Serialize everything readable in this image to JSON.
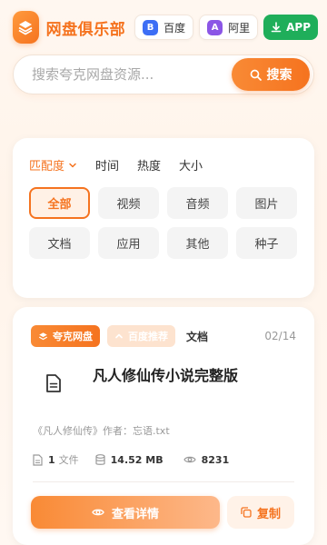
{
  "header": {
    "site_title": "网盘俱乐部",
    "baidu": {
      "badge": "B",
      "label": "百度"
    },
    "aliyun": {
      "badge": "A",
      "label": "阿里"
    },
    "app_label": "APP"
  },
  "search": {
    "placeholder": "搜索夸克网盘资源...",
    "button_label": "搜索"
  },
  "sort": {
    "items": [
      "匹配度",
      "时间",
      "热度",
      "大小"
    ],
    "active": "匹配度"
  },
  "categories": [
    "全部",
    "视频",
    "音频",
    "图片",
    "文档",
    "应用",
    "其他",
    "种子"
  ],
  "result": {
    "tags": [
      "夸克网盘",
      "百度推荐"
    ],
    "type": "文档",
    "page": "02/14",
    "title": "凡人修仙传小说完整版",
    "description": "《凡人修仙传》作者：忘语.txt",
    "file_count": "1",
    "file_unit": "文件",
    "size": "14.52 MB",
    "views": "8231",
    "detail_label": "查看详情",
    "copy_label": "复制"
  },
  "colors": {
    "accent": "#f5731f",
    "baidu": "#3d6ef5",
    "aliyun": "#8b56e6",
    "app": "#1fae5a"
  }
}
